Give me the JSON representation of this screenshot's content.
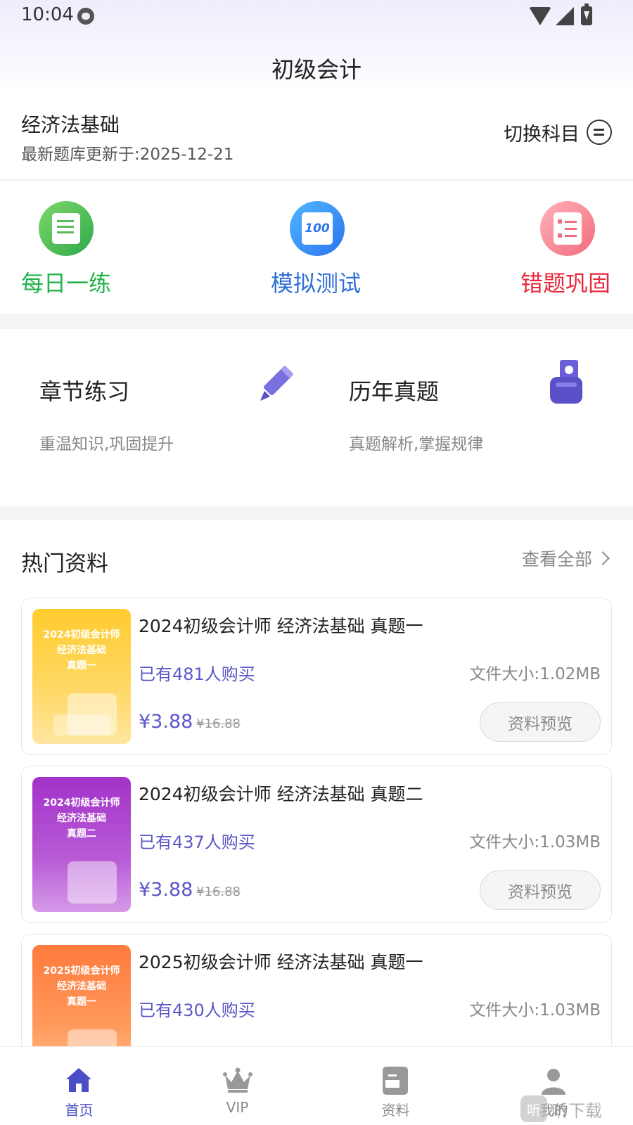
{
  "status_bar": {
    "time": "10:04"
  },
  "header": {
    "title": "初级会计"
  },
  "subject": {
    "name": "经济法基础",
    "update_text": "最新题库更新于:2025-12-21",
    "switch_label": "切换科目"
  },
  "quick_actions": [
    {
      "label": "每日一练",
      "icon": "daily-practice-icon",
      "color": "#21b24a"
    },
    {
      "label": "模拟测试",
      "icon": "mock-test-100-icon",
      "color": "#2e6fd6"
    },
    {
      "label": "错题巩固",
      "icon": "wrong-questions-icon",
      "color": "#e8283c"
    }
  ],
  "practice_cards": [
    {
      "title": "章节练习",
      "desc": "重温知识,巩固提升",
      "icon": "pencil-icon"
    },
    {
      "title": "历年真题",
      "desc": "真题解析,掌握规律",
      "icon": "hand-money-icon"
    }
  ],
  "hot_materials": {
    "title": "热门资料",
    "view_all": "查看全部",
    "items": [
      {
        "cover_text": [
          "2024初级会计师",
          "经济法基础",
          "真题一"
        ],
        "title": "2024初级会计师 经济法基础 真题一",
        "buyers": "已有481人购买",
        "size": "文件大小:1.02MB",
        "price": "¥3.88",
        "old_price": "¥16.88",
        "preview_label": "资料预览"
      },
      {
        "cover_text": [
          "2024初级会计师",
          "经济法基础",
          "真题二"
        ],
        "title": "2024初级会计师 经济法基础 真题二",
        "buyers": "已有437人购买",
        "size": "文件大小:1.03MB",
        "price": "¥3.88",
        "old_price": "¥16.88",
        "preview_label": "资料预览"
      },
      {
        "cover_text": [
          "2025初级会计师",
          "经济法基础",
          "真题一"
        ],
        "title": "2025初级会计师 经济法基础 真题一",
        "buyers": "已有430人购买",
        "size": "文件大小:1.03MB"
      }
    ]
  },
  "tabbar": [
    {
      "label": "首页",
      "icon": "home-icon",
      "active": true
    },
    {
      "label": "VIP",
      "icon": "crown-icon",
      "active": false
    },
    {
      "label": "资料",
      "icon": "document-icon",
      "active": false
    },
    {
      "label": "我的",
      "icon": "user-icon",
      "active": false
    }
  ],
  "watermark": {
    "logo_text": "听",
    "text": "听下载"
  },
  "colors": {
    "accent": "#5a57c8",
    "tab_active": "#4a4cc8",
    "header_bg": "#f0ecfb"
  }
}
